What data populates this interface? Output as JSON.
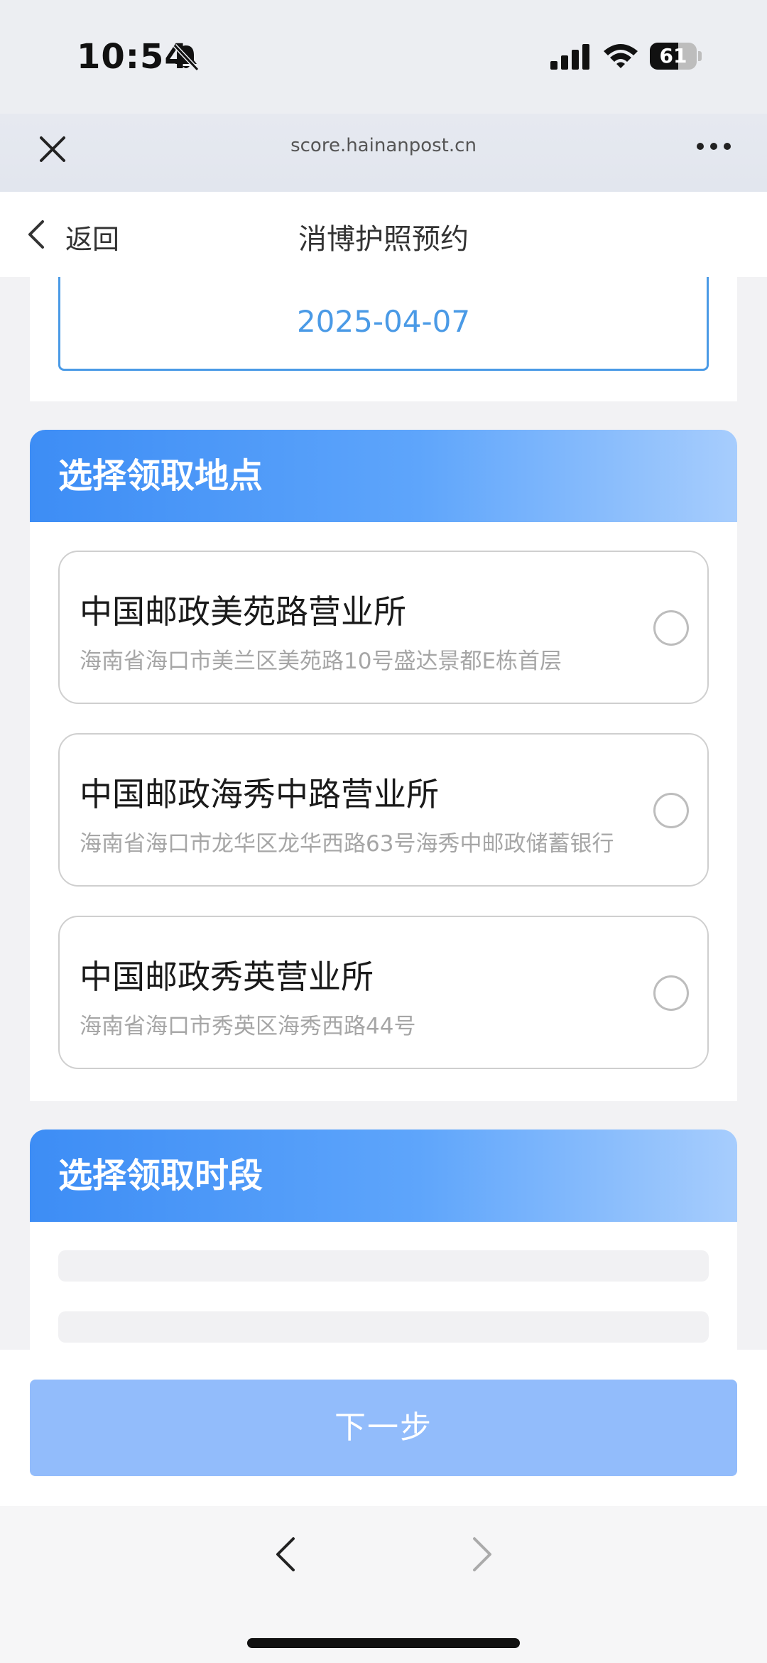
{
  "status_bar": {
    "time": "10:54",
    "battery_level": "61",
    "battery_fraction": 0.61,
    "icons": [
      "bell-slash-icon",
      "signal-icon",
      "wifi-icon",
      "battery-icon"
    ]
  },
  "browser": {
    "url": "score.hainanpost.cn",
    "icons": [
      "close-icon",
      "more-icon"
    ]
  },
  "nav": {
    "back_label": "返回",
    "title": "消博护照预约"
  },
  "date": {
    "value": "2025-04-07"
  },
  "location_section": {
    "title": "选择领取地点",
    "items": [
      {
        "name": "中国邮政美苑路营业所",
        "address": "海南省海口市美兰区美苑路10号盛达景都E栋首层",
        "selected": false
      },
      {
        "name": "中国邮政海秀中路营业所",
        "address": "海南省海口市龙华区龙华西路63号海秀中邮政储蓄银行",
        "selected": false
      },
      {
        "name": "中国邮政秀英营业所",
        "address": "海南省海口市秀英区海秀西路44号",
        "selected": false
      }
    ]
  },
  "time_section": {
    "title": "选择领取时段"
  },
  "footer": {
    "next_label": "下一步"
  },
  "colors": {
    "accent": "#3d8df5",
    "date_text": "#4a9ae6",
    "button_disabled": "#92bcfb"
  }
}
